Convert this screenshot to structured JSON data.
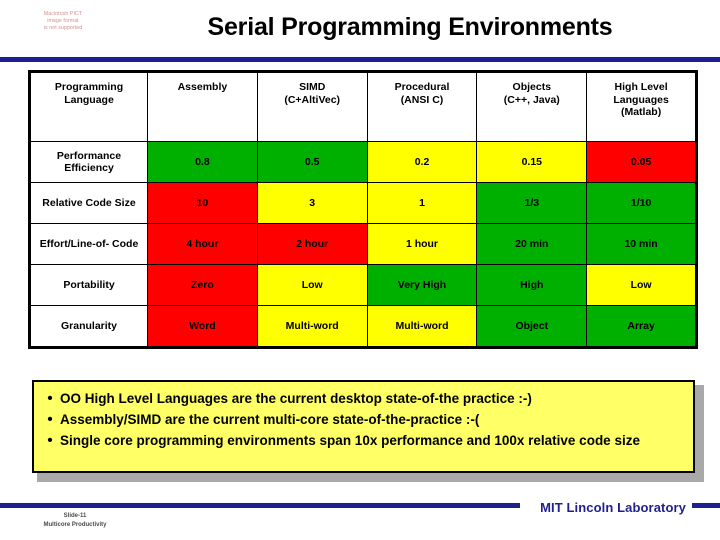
{
  "header": {
    "title": "Serial Programming Environments",
    "image_placeholder": {
      "line1": "Macintosh PICT",
      "line2": "image format",
      "line3": "is not supported"
    }
  },
  "table": {
    "columns": [
      {
        "label": "Programming Language",
        "line1": "Programming",
        "line2": "Language",
        "line3": ""
      },
      {
        "label": "Assembly",
        "line1": "Assembly",
        "line2": "",
        "line3": ""
      },
      {
        "label": "SIMD (C+AltiVec)",
        "line1": "SIMD",
        "line2": "(C+AltiVec)",
        "line3": ""
      },
      {
        "label": "Procedural (ANSI C)",
        "line1": "Procedural",
        "line2": "(ANSI C)",
        "line3": ""
      },
      {
        "label": "Objects (C++, Java)",
        "line1": "Objects",
        "line2": "(C++, Java)",
        "line3": ""
      },
      {
        "label": "High Level Languages (Matlab)",
        "line1": "High Level",
        "line2": "Languages",
        "line3": "(Matlab)"
      }
    ],
    "rows": [
      {
        "label_line1": "Performance",
        "label_line2": "Efficiency",
        "cells": [
          {
            "value": "0.8",
            "color": "green"
          },
          {
            "value": "0.5",
            "color": "green"
          },
          {
            "value": "0.2",
            "color": "yellow"
          },
          {
            "value": "0.15",
            "color": "yellow"
          },
          {
            "value": "0.05",
            "color": "red"
          }
        ]
      },
      {
        "label_line1": "Relative Code",
        "label_line2": "Size",
        "cells": [
          {
            "value": "10",
            "color": "red"
          },
          {
            "value": "3",
            "color": "yellow"
          },
          {
            "value": "1",
            "color": "yellow"
          },
          {
            "value": "1/3",
            "color": "green"
          },
          {
            "value": "1/10",
            "color": "green"
          }
        ]
      },
      {
        "label_line1": "Effort/Line-of-",
        "label_line2": "Code",
        "cells": [
          {
            "value": "4 hour",
            "color": "red"
          },
          {
            "value": "2 hour",
            "color": "red"
          },
          {
            "value": "1 hour",
            "color": "yellow"
          },
          {
            "value": "20 min",
            "color": "green"
          },
          {
            "value": "10 min",
            "color": "green"
          }
        ]
      },
      {
        "label_line1": "Portability",
        "label_line2": "",
        "cells": [
          {
            "value": "Zero",
            "color": "red"
          },
          {
            "value": "Low",
            "color": "yellow"
          },
          {
            "value": "Very High",
            "color": "green"
          },
          {
            "value": "High",
            "color": "green"
          },
          {
            "value": "Low",
            "color": "yellow"
          }
        ]
      },
      {
        "label_line1": "Granularity",
        "label_line2": "",
        "cells": [
          {
            "value": "Word",
            "color": "red"
          },
          {
            "value": "Multi-word",
            "color": "yellow"
          },
          {
            "value": "Multi-word",
            "color": "yellow"
          },
          {
            "value": "Object",
            "color": "green"
          },
          {
            "value": "Array",
            "color": "green"
          }
        ]
      }
    ]
  },
  "bullets": [
    {
      "marker": "•",
      "text": "OO High Level Languages are the current desktop state-of-the practice :-)"
    },
    {
      "marker": "•",
      "text": "Assembly/SIMD are the current multi-core state-of-the-practice :-("
    },
    {
      "marker": "•",
      "text": "Single core programming environments span 10x performance and 100x relative code size"
    }
  ],
  "footer": {
    "organization": "MIT Lincoln Laboratory",
    "slide_number": "Slide-11",
    "deck_title": "Multicore Productivity"
  },
  "colors": {
    "green": "#00b000",
    "yellow": "#ffff00",
    "red": "#ff0000",
    "accent_blue": "#1f1f8f",
    "callout_bg": "#ffff66"
  }
}
